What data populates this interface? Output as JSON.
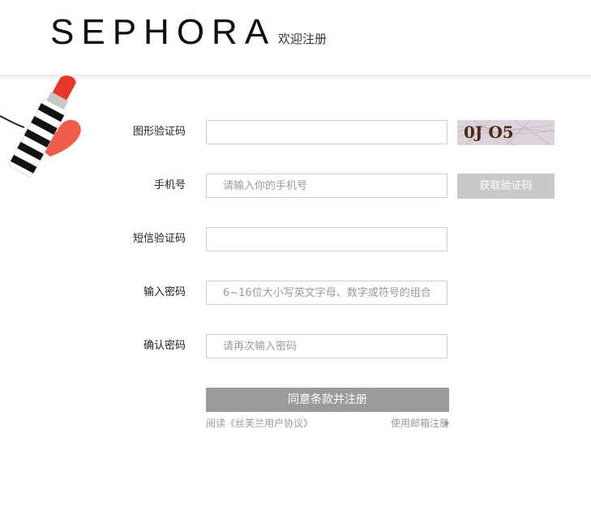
{
  "header": {
    "logo_text": "SEPHORA",
    "title": "欢迎注册"
  },
  "form": {
    "captcha_label": "图形验证码",
    "captcha_value": "",
    "captcha_image_text": "0J O5",
    "phone_label": "手机号",
    "phone_placeholder": "请输入你的手机号",
    "sms_button_label": "获取验证码",
    "sms_code_label": "短信验证码",
    "sms_code_value": "",
    "password_label": "输入密码",
    "password_placeholder": "6~16位大小写英文字母、数字或符号的组合",
    "confirm_label": "确认密码",
    "confirm_placeholder": "请再次输入密码",
    "submit_label": "同意条款并注册",
    "agreement_text": "阅读《丝芙兰用户协议》",
    "email_register_text": "使用邮箱注册"
  },
  "colors": {
    "submit_bg": "#9b9b9b",
    "sms_button_bg": "#c9c9c9",
    "lipstick_red": "#e8372a"
  },
  "icons": {
    "email_arrow": "caret-right-icon",
    "decoration": "lipstick-icon"
  }
}
